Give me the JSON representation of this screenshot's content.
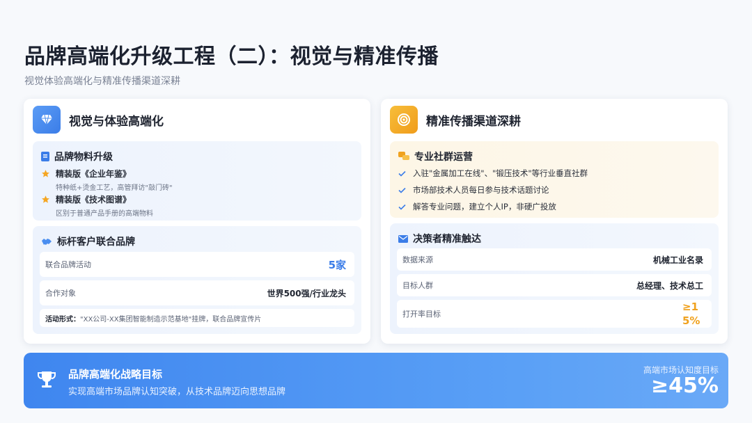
{
  "header": {
    "title": "品牌高端化升级工程（二）：视觉与精准传播",
    "subtitle": "视觉体验高端化与精准传播渠道深耕"
  },
  "left_card": {
    "title": "视觉与体验高端化",
    "icon": "diamond-icon",
    "accent": "#3b7de8",
    "materials": {
      "title": "品牌物料升级",
      "icon": "book-icon",
      "items": [
        {
          "label": "精装版《企业年鉴》",
          "desc": "特种纸+烫金工艺，高管拜访\"敲门砖\""
        },
        {
          "label": "精装版《技术图谱》",
          "desc": "区别于普通产品手册的高端物料"
        }
      ]
    },
    "cobrand": {
      "title": "标杆客户联合品牌",
      "icon": "handshake-icon",
      "rows": [
        {
          "key": "联合品牌活动",
          "value": "5家"
        },
        {
          "key": "合作对象",
          "value": "世界500强/行业龙头"
        }
      ],
      "note_label": "活动形式：",
      "note_text": "\"XX公司-XX集团智能制造示范基地\"挂牌，联合品牌宣传片"
    }
  },
  "right_card": {
    "title": "精准传播渠道深耕",
    "icon": "target-icon",
    "accent": "#f0a21f",
    "community": {
      "title": "专业社群运营",
      "icon": "chat-icon",
      "items": [
        "入驻\"金属加工在线\"、\"锻压技术\"等行业垂直社群",
        "市场部技术人员每日参与技术话题讨论",
        "解答专业问题，建立个人IP，非硬广投放"
      ]
    },
    "reach": {
      "title": "决策者精准触达",
      "icon": "mail-icon",
      "rows": [
        {
          "key": "数据来源",
          "value": "机械工业名录"
        },
        {
          "key": "目标人群",
          "value": "总经理、技术总工"
        },
        {
          "key": "打开率目标",
          "value": "≥15%"
        }
      ]
    }
  },
  "banner": {
    "icon": "trophy-icon",
    "title": "品牌高端化战略目标",
    "subtitle": "实现高端市场品牌认知突破，从技术品牌迈向思想品牌",
    "metric_label": "高端市场认知度目标",
    "metric_value": "≥45%"
  }
}
